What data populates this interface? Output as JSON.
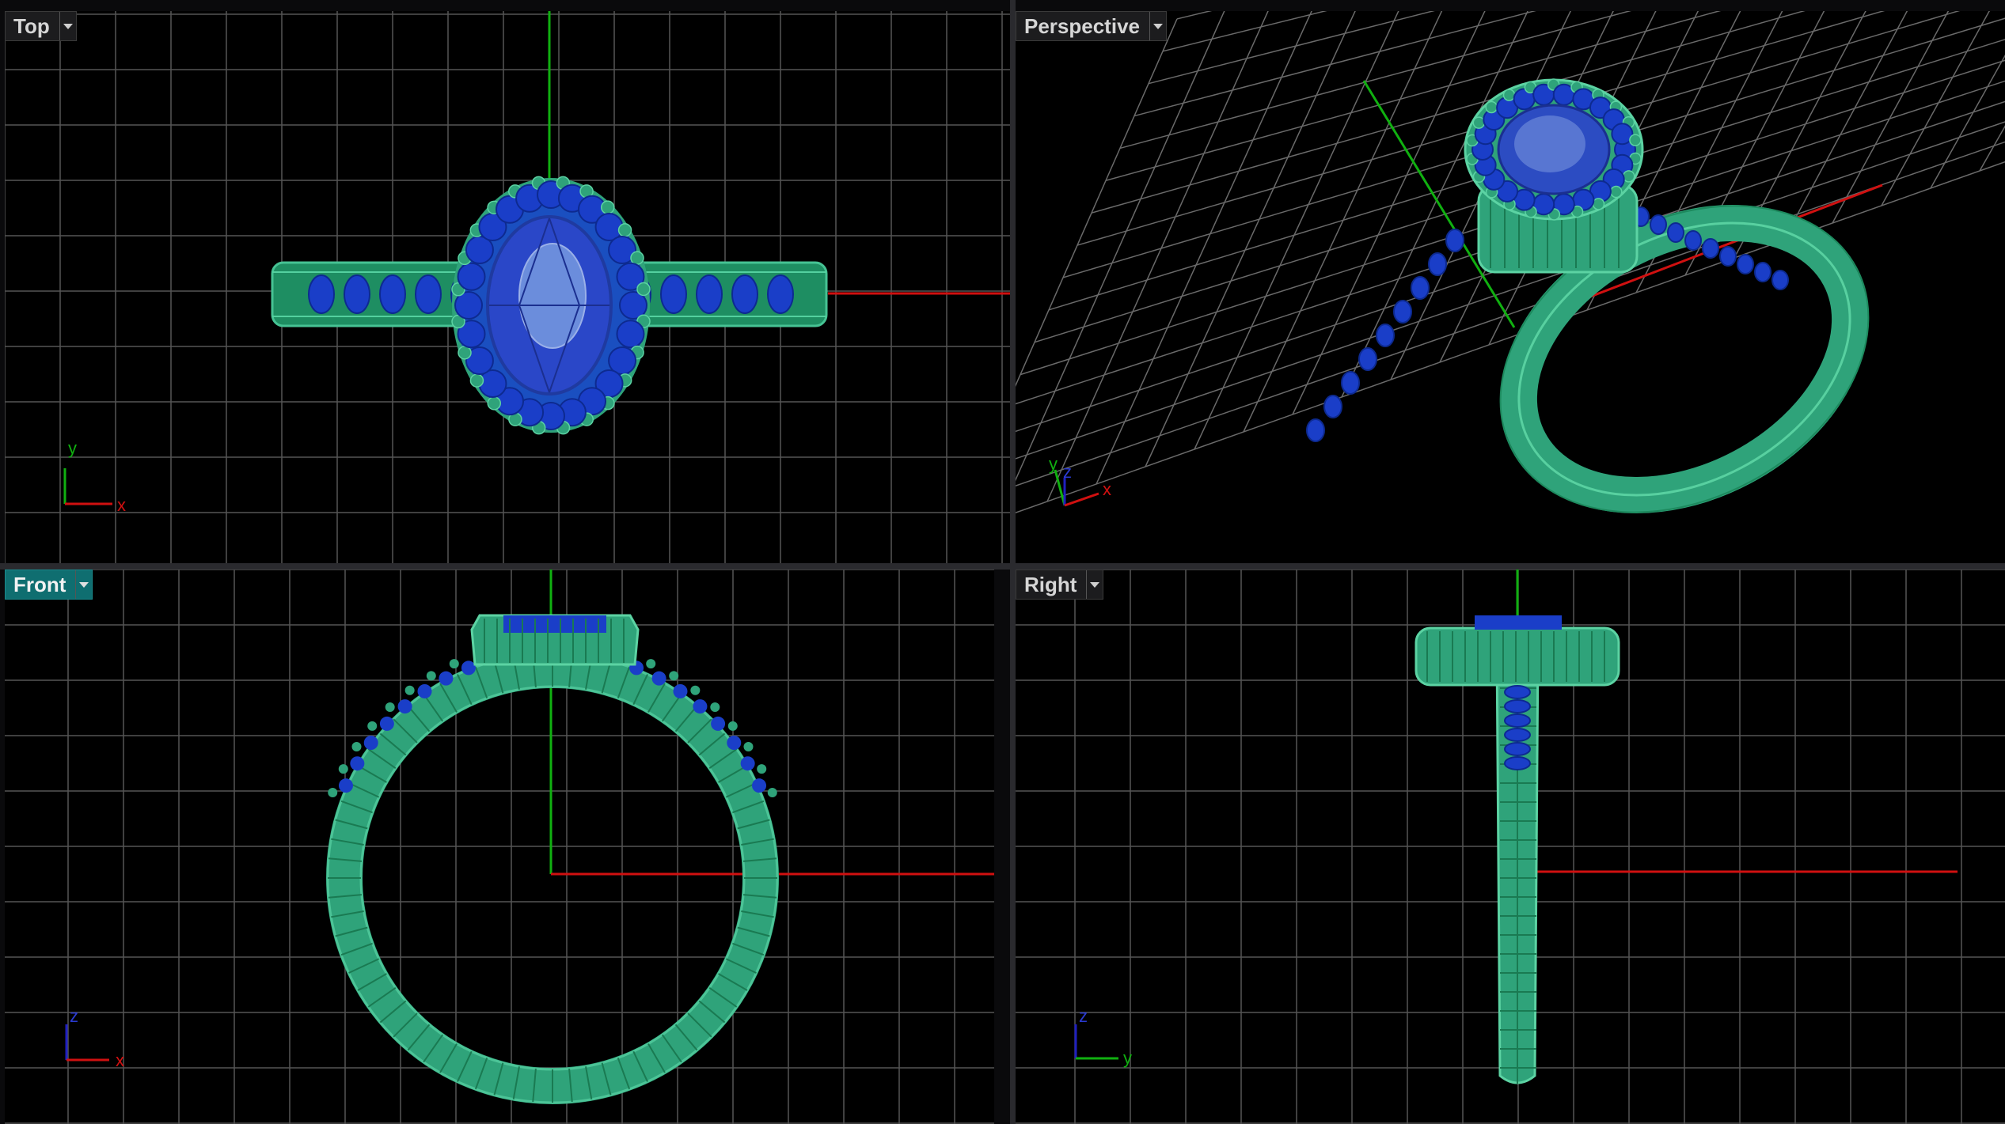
{
  "viewports": {
    "top": {
      "label": "Top",
      "active": false,
      "axes": [
        "y",
        "x"
      ]
    },
    "perspective": {
      "label": "Perspective",
      "active": false,
      "axes": [
        "y",
        "z",
        "x"
      ]
    },
    "front": {
      "label": "Front",
      "active": true,
      "axes": [
        "z",
        "x"
      ]
    },
    "right": {
      "label": "Right",
      "active": false,
      "axes": [
        "z",
        "y"
      ]
    }
  },
  "colors": {
    "background": "#000000",
    "grid": "#5a5a5a",
    "x_axis": "#d01010",
    "y_axis": "#10b010",
    "z_axis": "#2020c0",
    "metal": "#2fa37a",
    "gem": "#1a3ec8",
    "center_stone": "#5c7fd8",
    "active_tab": "#0f6e70"
  },
  "icons": [
    "chevron-down-icon",
    "axis-gizmo-icon"
  ]
}
